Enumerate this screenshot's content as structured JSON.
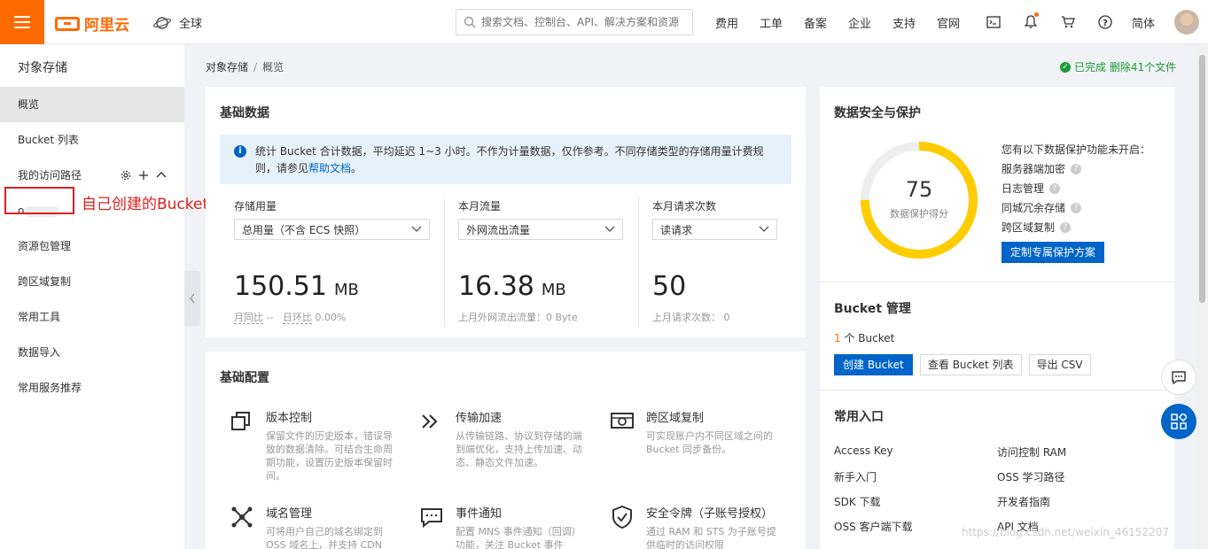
{
  "topbar": {
    "brand": "阿里云",
    "region": "全球",
    "search_placeholder": "搜索文档、控制台、API、解决方案和资源",
    "nav": [
      "费用",
      "工单",
      "备案",
      "企业",
      "支持",
      "官网"
    ],
    "lang": "简体"
  },
  "sidebar": {
    "title": "对象存储",
    "items": {
      "overview": "概览",
      "bucket_list": "Bucket 列表",
      "my_paths": "我的访问路径",
      "bucket_name": "o",
      "resource_pkg": "资源包管理",
      "cross_region": "跨区域复制",
      "tools": "常用工具",
      "import": "数据导入",
      "recommend": "常用服务推荐"
    },
    "annotation": "自己创建的Bucket"
  },
  "breadcrumb": {
    "root": "对象存储",
    "sep": "/",
    "current": "概览"
  },
  "status": {
    "done_text": "已完成 删除41个文件"
  },
  "basic_data": {
    "title": "基础数据",
    "info_text": "统计 Bucket 合计数据，平均延迟 1~3 小时。不作为计量数据，仅作参考。不同存储类型的存储用量计费规则，请参见",
    "info_link": "帮助文档",
    "info_end": "。",
    "storage": {
      "label": "存储用量",
      "select": "总用量（不含 ECS 快照）",
      "value": "150.51",
      "unit": "MB",
      "yoy_label": "月同比",
      "yoy_value": "--",
      "dod_label": "日环比",
      "dod_value": "0.00%"
    },
    "traffic": {
      "label": "本月流量",
      "select": "外网流出流量",
      "value": "16.38",
      "unit": "MB",
      "sub": "上月外网流出流量：0 Byte"
    },
    "requests": {
      "label": "本月请求次数",
      "select": "读请求",
      "value": "50",
      "sub": "上月请求次数：  0"
    }
  },
  "basic_config": {
    "title": "基础配置",
    "features": [
      {
        "title": "版本控制",
        "desc": "保留文件的历史版本，错误导致的数据清除。可结合生命周期功能，设置历史版本保留时间。"
      },
      {
        "title": "传输加速",
        "desc": "从传输链路、协议到存储的端到端优化，支持上传加速、动态、静态文件加速。"
      },
      {
        "title": "跨区域复制",
        "desc": "可实现账户内不同区域之间的 Bucket 同步备份。"
      },
      {
        "title": "域名管理",
        "desc": "可将用户自己的域名绑定到 OSS 域名上，并支持 CDN"
      },
      {
        "title": "事件通知",
        "desc": "配置 MNS 事件通知（回调）功能，关注 Bucket 事件"
      },
      {
        "title": "安全令牌（子账号授权）",
        "desc": "通过 RAM 和 STS 为子账号提供临时的访问权限"
      }
    ]
  },
  "security": {
    "title": "数据安全与保护",
    "score": "75",
    "score_label": "数据保护得分",
    "score_fraction": 0.75,
    "intro": "您有以下数据保护功能未开启：",
    "items": [
      "服务器端加密",
      "日志管理",
      "同城冗余存储",
      "跨区域复制"
    ],
    "button": "定制专属保护方案"
  },
  "bucket_mgmt": {
    "title": "Bucket 管理",
    "count": "1",
    "count_suffix": " 个 Bucket",
    "create": "创建 Bucket",
    "view": "查看 Bucket 列表",
    "export": "导出 CSV"
  },
  "entries": {
    "title": "常用入口",
    "left": [
      "Access Key",
      "新手入门",
      "SDK 下载",
      "OSS 客户端下载"
    ],
    "right": [
      "访问控制 RAM",
      "OSS 学习路径",
      "开发者指南",
      "API 文档"
    ]
  },
  "watermark": "https://blog.csdn.net/weixin_46152207",
  "colors": {
    "brand": "#ff6a00",
    "primary": "#0064c8",
    "gauge": "#ffcc00",
    "success": "#1a9b35",
    "annotation": "#e02020"
  }
}
